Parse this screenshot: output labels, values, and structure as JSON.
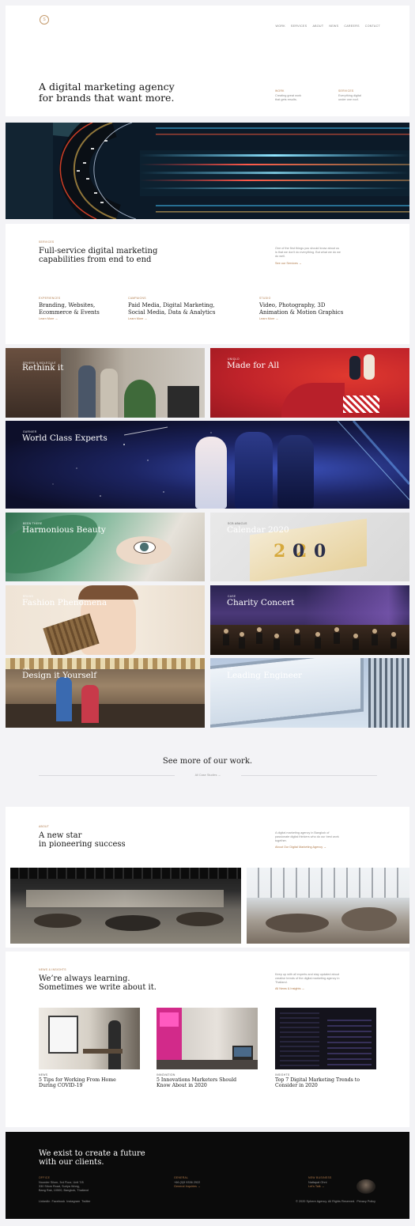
{
  "header": {
    "nav": [
      "WORK",
      "SERVICES",
      "ABOUT",
      "NEWS",
      "CAREERS",
      "CONTACT"
    ],
    "hero_title_1": "A digital marketing agency",
    "hero_title_2": "for brands that want more.",
    "col1_label": "WORK",
    "col1_text_1": "Creating great work",
    "col1_text_2": "that gets results.",
    "col2_label": "SERVICES",
    "col2_text_1": "Everything digital",
    "col2_text_2": "under one roof."
  },
  "services": {
    "label": "SERVICES",
    "title_1": "Full-service digital marketing",
    "title_2": "capabilities from end to end",
    "intro_1": "One of the first things you should know about us",
    "intro_2": "is that we don't do everything. But what we do we",
    "intro_3": "do well.",
    "intro_link": "See our Services →",
    "columns": [
      {
        "label": "EXPERIENCES",
        "line1": "Branding, Websites,",
        "line2": "Ecommerce & Events",
        "link": "Learn More →"
      },
      {
        "label": "CAMPAIGNS",
        "line1": "Paid Media, Digital Marketing,",
        "line2": "Social Media, Data & Analytics",
        "link": "Learn More →"
      },
      {
        "label": "STUDIO",
        "line1": "Video, Photography, 3D",
        "line2": "Animation & Motion Graphics",
        "link": "Learn More →"
      }
    ]
  },
  "work": {
    "tiles": [
      {
        "cat": "SPHERE & MOLECULE",
        "title": "Rethink it"
      },
      {
        "cat": "UNIQLO",
        "title": "Made for All"
      },
      {
        "cat": "GARNIER",
        "title": "World Class Experts"
      },
      {
        "cat": "BEEN THERE",
        "title": "Harmonious Beauty"
      },
      {
        "cat": "SCB ABACUS",
        "title": "Calendar 2020"
      },
      {
        "cat": "BRAND",
        "title": "Fashion Phenomena"
      },
      {
        "cat": "CASE",
        "title": "Charity Concert"
      },
      {
        "cat": "IKEA",
        "title": "Design it Yourself"
      },
      {
        "cat": "ITD",
        "title": "Leading Engineer"
      }
    ],
    "more_title": "See more of our work.",
    "more_link": "All Case Studies →"
  },
  "about": {
    "label": "ABOUT",
    "title_1": "A new star",
    "title_2": "in pioneering success",
    "text_1": "A digital marketing agency in Bangkok of",
    "text_2": "passionate digital thinkers who do our best work",
    "text_3": "together.",
    "link": "About Our Digital Marketing Agency →"
  },
  "news": {
    "label": "NEWS & INSIGHTS",
    "title_1": "We’re always learning.",
    "title_2": "Sometimes we write about it.",
    "text_1": "Keep up with all experts and stay updated about",
    "text_2": "creative trends of the digital marketing agency in",
    "text_3": "Thailand.",
    "link": "All News & Insights →",
    "articles": [
      {
        "cat": "NEWS",
        "line1": "5 Tips for Working From Home",
        "line2": "During COVID-19"
      },
      {
        "cat": "INNOVATION",
        "line1": "5 Innovations Marketers Should",
        "line2": "Know About in 2020"
      },
      {
        "cat": "INSIGHTS",
        "line1": "Top 7 Digital Marketing Trends to",
        "line2": "Consider in 2020"
      }
    ]
  },
  "footer": {
    "title_1": "We exist to create a future",
    "title_2": "with our clients.",
    "office_label": "OFFICE",
    "office_1": "Noorder Silom, 3rd Floor, Unit 7/8",
    "office_2": "330 Silom Road, Suriya Wong,",
    "office_3": "Bang Rak, 10500, Bangkok, Thailand",
    "general_label": "GENERAL",
    "general_phone": "+66 (0)9 9336 2922",
    "general_link": "General Inquiries →",
    "business_label": "NEW BUSINESS",
    "business_name": "Nattapat Ohni",
    "business_link": "Let's Talk →",
    "social": "LinkedIn  Facebook  Instagram  Twitter",
    "copyright": "© 2020 Sphere Agency. All Rights Reserved.  Privacy Policy"
  },
  "colors": {
    "accent": "#b07a4a",
    "footer_bg": "#0b0b0b",
    "page_bg": "#f3f3f6"
  }
}
